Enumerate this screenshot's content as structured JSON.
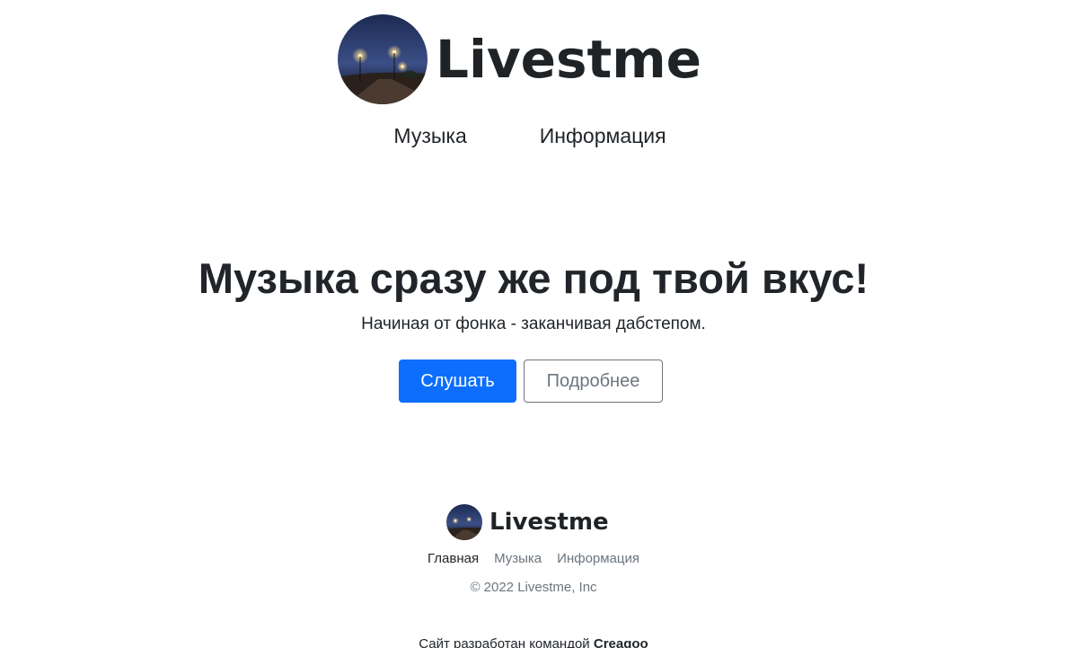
{
  "header": {
    "brand_name": "Livestme",
    "logo_icon": "night-street-photo",
    "nav": [
      {
        "label": "Музыка"
      },
      {
        "label": "Информация"
      }
    ]
  },
  "hero": {
    "title": "Музыка сразу же под твой вкус!",
    "subtitle": "Начиная от фонка - заканчивая дабстепом.",
    "primary_button": "Слушать",
    "secondary_button": "Подробнее"
  },
  "footer": {
    "brand_name": "Livestme",
    "nav": [
      {
        "label": "Главная"
      },
      {
        "label": "Музыка"
      },
      {
        "label": "Информация"
      }
    ],
    "copyright": "© 2022 Livestme, Inc",
    "credit_prefix": "Сайт разработан командой",
    "credit_team": "Creagoo"
  },
  "colors": {
    "primary": "#0d6efd",
    "text": "#212529",
    "muted": "#6c757d"
  }
}
